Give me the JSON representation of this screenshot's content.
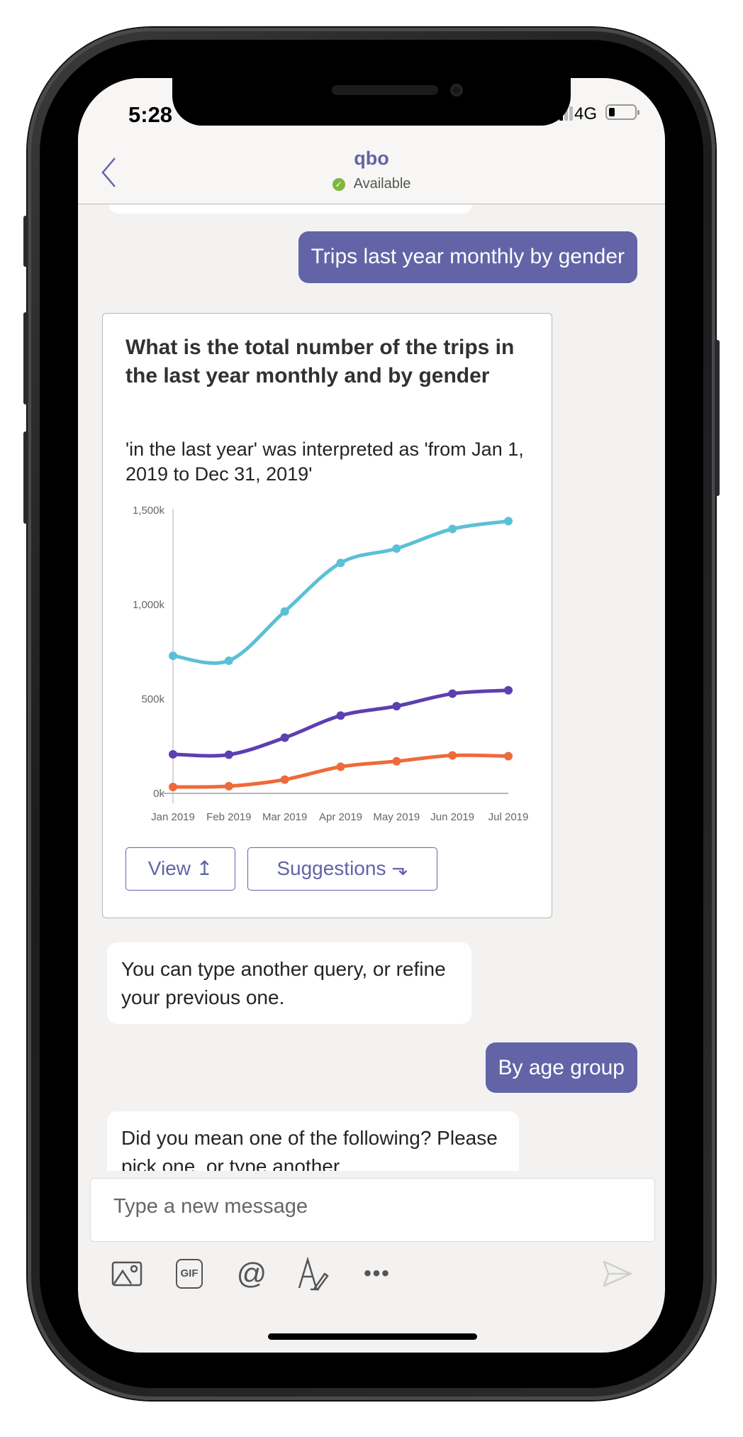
{
  "status_bar": {
    "time": "5:28",
    "network": "4G",
    "battery_level": 0.2
  },
  "header": {
    "title": "qbo",
    "presence": "Available",
    "presence_color": "#7db83d",
    "back_icon": "chevron-left-icon"
  },
  "messages": {
    "user_1": "Trips last year monthly by gender",
    "card": {
      "title": "What is the total number of the trips in the last year monthly and by gender",
      "subtitle": "'in the last year' was interpreted as 'from Jan 1, 2019 to Dec 31, 2019'",
      "view_label": "View ↥",
      "suggestions_label": "Suggestions ⬎"
    },
    "bot_1": "You can type another query, or refine your previous one.",
    "user_2": "By age group",
    "bot_2": "Did you mean one of the following? Please pick one, or type another"
  },
  "compose": {
    "placeholder": "Type a new message",
    "value": ""
  },
  "toolbar": {
    "icons": [
      "image-icon",
      "gif-icon",
      "mention-icon",
      "format-icon",
      "more-icon",
      "send-icon"
    ],
    "gif_label": "GIF"
  },
  "colors": {
    "accent": "#6264a7",
    "series": [
      "#5bc0d6",
      "#5c3fb0",
      "#ef6a3a"
    ]
  },
  "chart_data": {
    "type": "line",
    "categories": [
      "Jan 2019",
      "Feb 2019",
      "Mar 2019",
      "Apr 2019",
      "May 2019",
      "Jun 2019",
      "Jul 2019"
    ],
    "series": [
      {
        "values": [
          729,
          703,
          964,
          1221,
          1297,
          1401,
          1442
        ],
        "color": "#5bc0d6"
      },
      {
        "values": [
          207,
          205,
          295,
          412,
          462,
          528,
          546
        ],
        "color": "#5c3fb0"
      },
      {
        "values": [
          34,
          38,
          73,
          141,
          170,
          201,
          197
        ],
        "color": "#ef6a3a"
      }
    ],
    "y_ticks": [
      "0k",
      "500k",
      "1,000k",
      "1,500k"
    ],
    "ylim": [
      0,
      1500
    ],
    "y_unit": "thousands",
    "grid": false,
    "legend": "none"
  }
}
